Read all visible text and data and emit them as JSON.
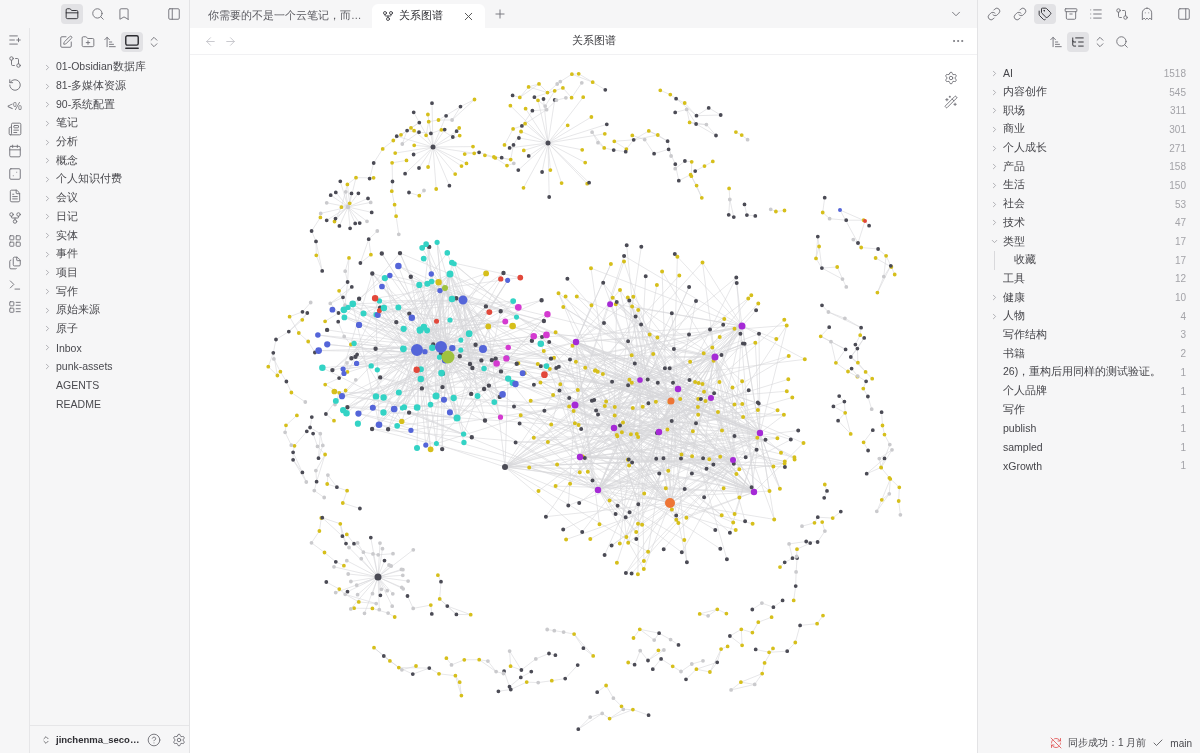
{
  "left_sidebar": {
    "view_tabs": [
      {
        "selected": true
      },
      {
        "selected": false
      },
      {
        "selected": false
      }
    ],
    "ribbon": {
      "template_glyph": "<%"
    },
    "file_nav": [
      {
        "on": false
      },
      {
        "on": false
      },
      {
        "on": false
      },
      {
        "on": true
      },
      {
        "on": false
      }
    ],
    "files": [
      {
        "label": "01-Obsidian数据库",
        "kind": "folder",
        "expanded": false
      },
      {
        "label": "81-多媒体资源",
        "kind": "folder",
        "expanded": false
      },
      {
        "label": "90-系统配置",
        "kind": "folder",
        "expanded": false
      },
      {
        "label": "笔记",
        "kind": "folder",
        "expanded": false
      },
      {
        "label": "分析",
        "kind": "folder",
        "expanded": false
      },
      {
        "label": "概念",
        "kind": "folder",
        "expanded": false
      },
      {
        "label": "个人知识付费",
        "kind": "folder",
        "expanded": false
      },
      {
        "label": "会议",
        "kind": "folder",
        "expanded": false
      },
      {
        "label": "日记",
        "kind": "folder",
        "expanded": false
      },
      {
        "label": "实体",
        "kind": "folder",
        "expanded": false
      },
      {
        "label": "事件",
        "kind": "folder",
        "expanded": false
      },
      {
        "label": "项目",
        "kind": "folder",
        "expanded": false
      },
      {
        "label": "写作",
        "kind": "folder",
        "expanded": false
      },
      {
        "label": "原始来源",
        "kind": "folder",
        "expanded": false
      },
      {
        "label": "原子",
        "kind": "folder",
        "expanded": false
      },
      {
        "label": "Inbox",
        "kind": "folder",
        "expanded": false
      },
      {
        "label": "punk-assets",
        "kind": "folder",
        "expanded": false
      },
      {
        "label": "AGENTS",
        "kind": "file"
      },
      {
        "label": "README",
        "kind": "file"
      }
    ],
    "vault": {
      "name": "jinchenma_seco…"
    }
  },
  "tabs": [
    {
      "label": "你需要的不是一个云笔记，而…",
      "selected": false,
      "kind": "note"
    },
    {
      "label": "关系图谱",
      "selected": true,
      "kind": "graph"
    }
  ],
  "header": {
    "title": "关系图谱"
  },
  "right_sidebar": {
    "view_tabs": [
      {
        "selected": false
      },
      {
        "selected": false
      },
      {
        "selected": true
      },
      {
        "selected": false
      },
      {
        "selected": false
      },
      {
        "selected": false
      },
      {
        "selected": false
      }
    ],
    "tag_nav": [
      {
        "on": false
      },
      {
        "on": true
      },
      {
        "on": false
      },
      {
        "on": false
      }
    ],
    "tags": [
      {
        "label": "AI",
        "count": "1518",
        "kind": "group",
        "expanded": false
      },
      {
        "label": "内容创作",
        "count": "545",
        "kind": "group",
        "expanded": false
      },
      {
        "label": "职场",
        "count": "311",
        "kind": "group",
        "expanded": false
      },
      {
        "label": "商业",
        "count": "301",
        "kind": "group",
        "expanded": false
      },
      {
        "label": "个人成长",
        "count": "271",
        "kind": "group",
        "expanded": false
      },
      {
        "label": "产品",
        "count": "158",
        "kind": "group",
        "expanded": false
      },
      {
        "label": "生活",
        "count": "150",
        "kind": "group",
        "expanded": false
      },
      {
        "label": "社会",
        "count": "53",
        "kind": "group",
        "expanded": false
      },
      {
        "label": "技术",
        "count": "47",
        "kind": "group",
        "expanded": false
      },
      {
        "label": "类型",
        "count": "17",
        "kind": "group",
        "expanded": true,
        "children": [
          {
            "label": "收藏",
            "count": "17",
            "kind": "tag"
          }
        ]
      },
      {
        "label": "工具",
        "count": "12",
        "kind": "tag"
      },
      {
        "label": "健康",
        "count": "10",
        "kind": "group",
        "expanded": false
      },
      {
        "label": "人物",
        "count": "4",
        "kind": "group",
        "expanded": false
      },
      {
        "label": "写作结构",
        "count": "3",
        "kind": "tag"
      },
      {
        "label": "书籍",
        "count": "2",
        "kind": "tag"
      },
      {
        "label": "26)，重构后用同样的测试验证。",
        "count": "1",
        "kind": "tag"
      },
      {
        "label": "个人品牌",
        "count": "1",
        "kind": "tag"
      },
      {
        "label": "写作",
        "count": "1",
        "kind": "tag"
      },
      {
        "label": "publish",
        "count": "1",
        "kind": "tag"
      },
      {
        "label": "sampled",
        "count": "1",
        "kind": "tag"
      },
      {
        "label": "xGrowth",
        "count": "1",
        "kind": "tag"
      }
    ]
  },
  "status_bar": {
    "sync": "同步成功：1 月前",
    "branch": "main"
  }
}
